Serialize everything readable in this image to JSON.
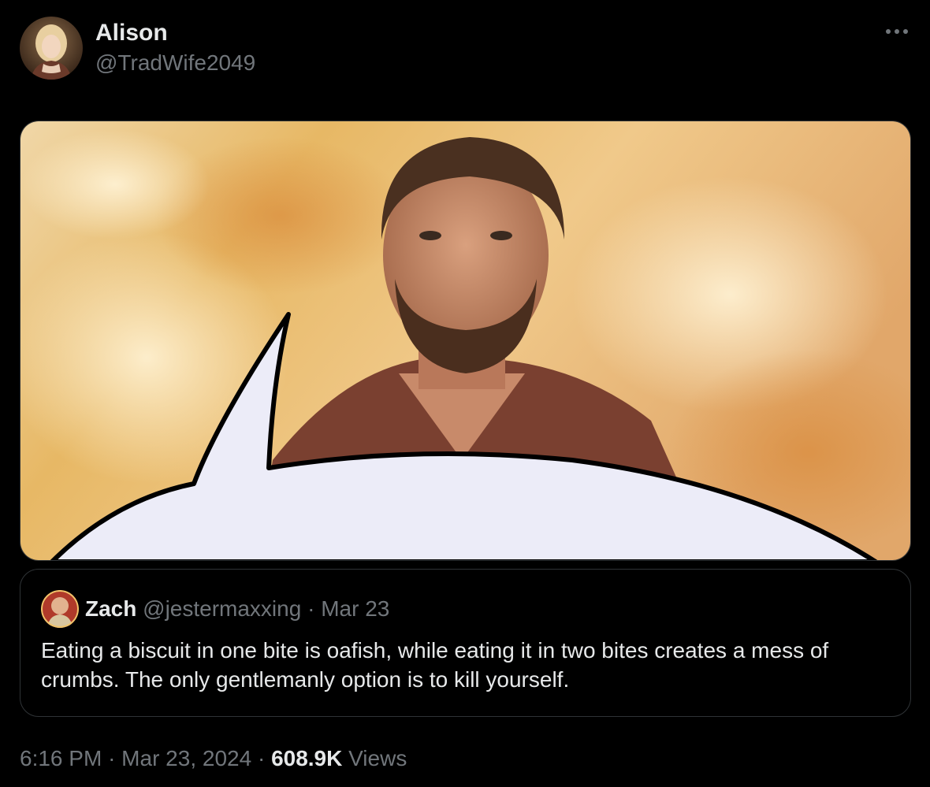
{
  "author": {
    "name": "Alison",
    "handle": "@TradWife2049",
    "avatar_icon": "user-avatar-woman-icon"
  },
  "more_icon": "more-dots-icon",
  "media": {
    "icon": "photo-image-icon",
    "accent_background": "#e6b25a",
    "speech_bubble_fill": "#ececf8"
  },
  "quote": {
    "name": "Zach",
    "handle": "@jestermaxxing",
    "separator": "·",
    "date": "Mar 23",
    "text": "Eating a biscuit in one bite is oafish, while eating it in two bites creates a mess of crumbs. The only gentlemanly option is to kill yourself."
  },
  "meta": {
    "time": "6:16 PM",
    "sep1": "·",
    "date": "Mar 23, 2024",
    "sep2": "·",
    "views_count": "608.9K",
    "views_label": "Views"
  },
  "colors": {
    "background": "#000000",
    "text_primary": "#e7e9ea",
    "text_secondary": "#71767b",
    "border": "#2f3336"
  }
}
